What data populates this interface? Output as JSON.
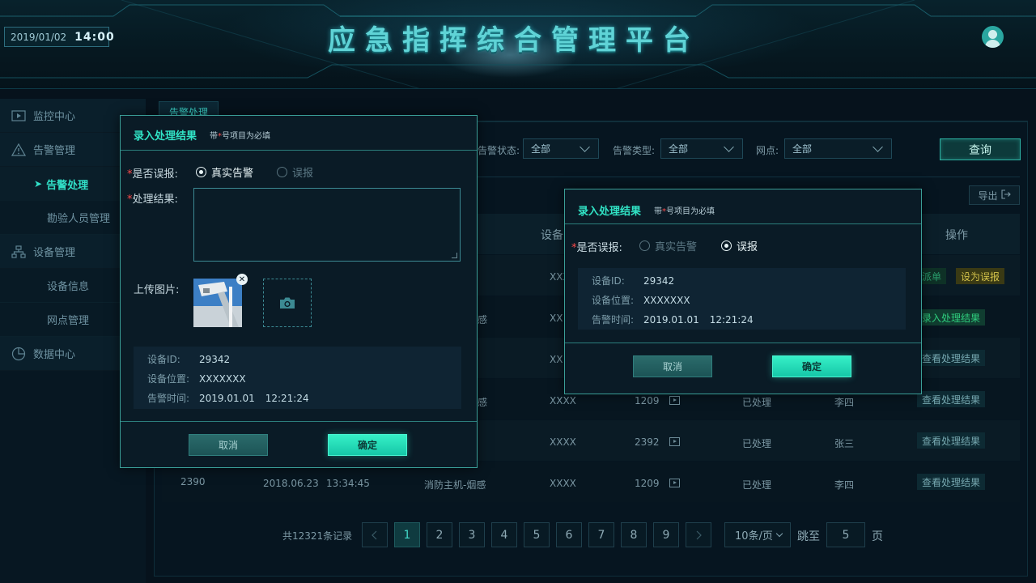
{
  "header": {
    "date": "2019/01/02",
    "time": "14:00",
    "title": "应急指挥综合管理平台"
  },
  "sidebar": {
    "items": [
      {
        "label": "监控中心",
        "icon": "monitor-play-icon"
      },
      {
        "label": "告警管理",
        "icon": "warning-triangle-icon"
      },
      {
        "label": "告警处理",
        "active": true
      },
      {
        "label": "勘验人员管理"
      },
      {
        "label": "设备管理",
        "icon": "device-network-icon"
      },
      {
        "label": "设备信息"
      },
      {
        "label": "网点管理"
      },
      {
        "label": "数据中心",
        "icon": "pie-chart-icon"
      }
    ]
  },
  "tab": {
    "label": "告警处理"
  },
  "filters": {
    "status_label": "告警状态:",
    "status_value": "全部",
    "type_label": "告警类型:",
    "type_value": "全部",
    "site_label": "网点:",
    "site_value": "全部",
    "query_button": "查询",
    "export_button": "导出"
  },
  "table": {
    "header_device": "设备",
    "header_op": "操作",
    "rows": [
      {
        "c_mid": "",
        "device": "XXX",
        "code": "",
        "status": "",
        "person": "",
        "ops": [
          "派单",
          "设为误报"
        ]
      },
      {
        "c_mid": "感",
        "device": "XX",
        "code": "",
        "status": "",
        "person": "",
        "ops": [
          "录入处理结果"
        ]
      },
      {
        "c_mid": "",
        "device": "XX",
        "code": "",
        "status": "",
        "person": "",
        "ops": [
          "查看处理结果"
        ]
      },
      {
        "c_mid": "感",
        "device": "XXXX",
        "code": "1209",
        "status": "已处理",
        "person": "李四",
        "ops": [
          "查看处理结果"
        ]
      },
      {
        "c_mid": "",
        "device": "XXXX",
        "code": "2392",
        "status": "已处理",
        "person": "张三",
        "ops": [
          "查看处理结果"
        ]
      },
      {
        "id": "2390",
        "date": "2018.06.23",
        "time": "13:34:45",
        "type": "消防主机-烟感",
        "device": "XXXX",
        "code": "1209",
        "status": "已处理",
        "person": "李四",
        "ops": [
          "查看处理结果"
        ]
      }
    ]
  },
  "pagination": {
    "total_text": "共12321条记录",
    "pages": [
      "1",
      "2",
      "3",
      "4",
      "5",
      "6",
      "7",
      "8",
      "9"
    ],
    "current": "1",
    "page_size": "10条/页",
    "jump_label": "跳至",
    "jump_value": "5",
    "page_unit": "页"
  },
  "dialog_a": {
    "title": "录入处理结果",
    "hint_prefix": "带",
    "hint_star": "*",
    "hint_suffix": "号项目为必填",
    "false_alarm_label": "是否误报:",
    "option_real": "真实告警",
    "option_false": "误报",
    "selected": "真实告警",
    "result_label": "处理结果:",
    "result_value": "",
    "upload_label": "上传图片:",
    "device_id_label": "设备ID:",
    "device_id": "29342",
    "location_label": "设备位置:",
    "location": "XXXXXXX",
    "alarm_time_label": "告警时间:",
    "alarm_date": "2019.01.01",
    "alarm_time": "12:21:24",
    "cancel": "取消",
    "confirm": "确定"
  },
  "dialog_b": {
    "title": "录入处理结果",
    "hint_prefix": "带",
    "hint_star": "*",
    "hint_suffix": "号项目为必填",
    "false_alarm_label": "是否误报:",
    "option_real": "真实告警",
    "option_false": "误报",
    "selected": "误报",
    "device_id_label": "设备ID:",
    "device_id": "29342",
    "location_label": "设备位置:",
    "location": "XXXXXXX",
    "alarm_time_label": "告警时间:",
    "alarm_date": "2019.01.01",
    "alarm_time": "12:21:24",
    "cancel": "取消",
    "confirm": "确定"
  },
  "colors": {
    "accent": "#31e4c6",
    "background": "#06121c",
    "required": "#ff4b4b"
  }
}
